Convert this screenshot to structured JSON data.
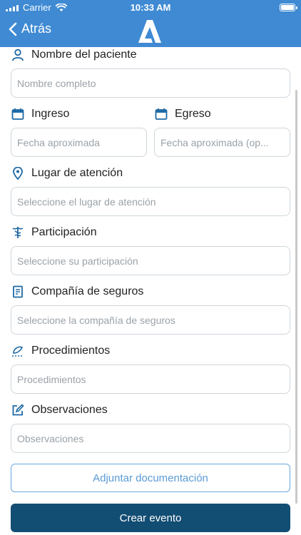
{
  "status_bar": {
    "carrier": "Carrier",
    "time": "10:33 AM"
  },
  "nav": {
    "back_label": "Atrás",
    "logo_icon": "brand-a-logo"
  },
  "colors": {
    "header": "#3f8ad3",
    "icon": "#1f6aa5",
    "primary_button": "#124d73",
    "outline_button": "#5b9bd5",
    "placeholder": "#9aa2a9"
  },
  "form": {
    "patient": {
      "label": "Nombre del paciente",
      "placeholder": "Nombre completo",
      "icon": "person-icon"
    },
    "admission": {
      "label": "Ingreso",
      "placeholder": "Fecha aproximada",
      "icon": "calendar-icon"
    },
    "discharge": {
      "label": "Egreso",
      "placeholder": "Fecha aproximada (op...",
      "icon": "calendar-icon"
    },
    "location": {
      "label": "Lugar de atención",
      "placeholder": "Seleccione el lugar de atención",
      "icon": "map-pin-icon"
    },
    "participation": {
      "label": "Participación",
      "placeholder": "Seleccione su participación",
      "icon": "caduceus-icon"
    },
    "insurance": {
      "label": "Compañía de seguros",
      "placeholder": "Seleccione la compañía de seguros",
      "icon": "insurance-document-icon"
    },
    "procedures": {
      "label": "Procedimientos",
      "placeholder": "Procedimientos",
      "icon": "procedure-icon"
    },
    "observations": {
      "label": "Observaciones",
      "placeholder": "Observaciones",
      "icon": "edit-icon"
    }
  },
  "actions": {
    "attach_label": "Adjuntar documentación",
    "create_label": "Crear evento"
  }
}
